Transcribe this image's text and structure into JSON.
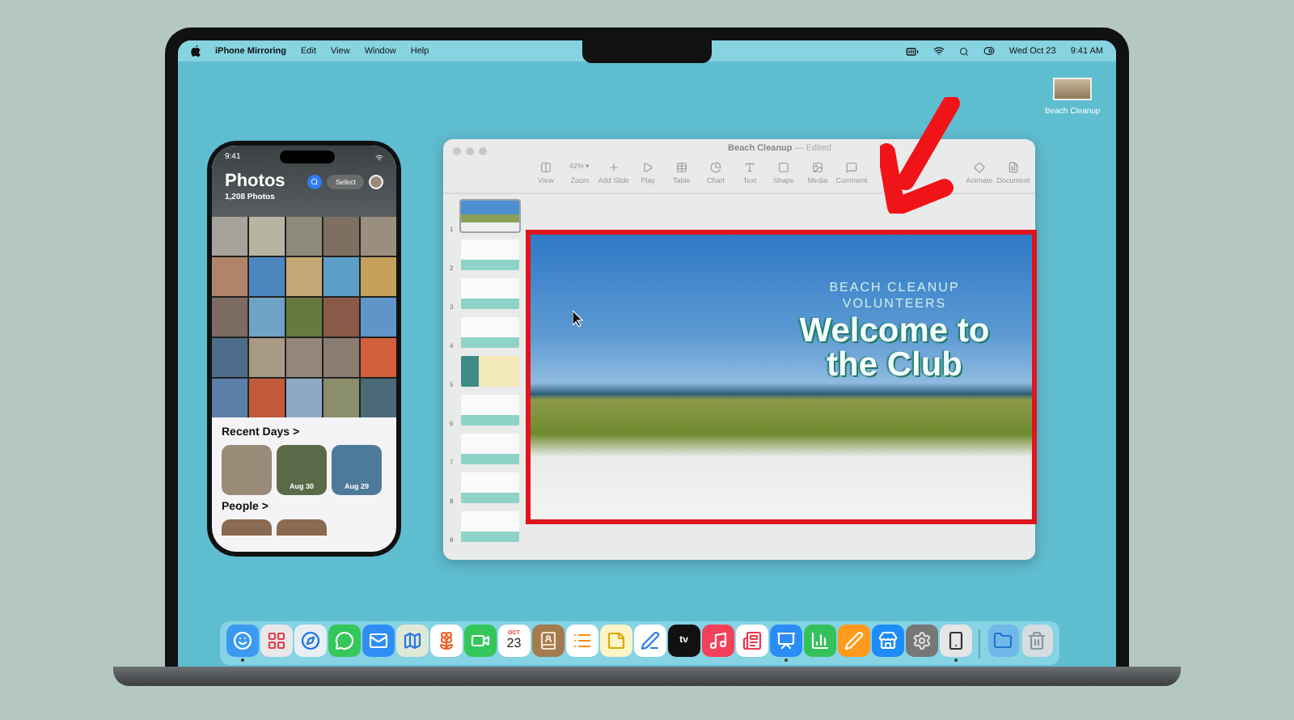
{
  "menu_bar": {
    "app_name": "iPhone Mirroring",
    "menus": [
      "Edit",
      "View",
      "Window",
      "Help"
    ],
    "date": "Wed Oct 23",
    "time": "9:41 AM"
  },
  "desktop_icon": {
    "label": "Beach Cleanup"
  },
  "iphone": {
    "status_time": "9:41",
    "title": "Photos",
    "count": "1,208 Photos",
    "select_button": "Select",
    "recent_days": {
      "heading": "Recent Days",
      "chevron": ">",
      "tiles": [
        {
          "kind": "photo"
        },
        {
          "kind": "photo",
          "label": "Aug 30"
        },
        {
          "kind": "photo",
          "label": "Aug 29"
        }
      ]
    },
    "people": {
      "heading": "People",
      "chevron": ">"
    }
  },
  "keynote": {
    "title": "Beach Cleanup",
    "status": "— Edited",
    "zoom": "42%",
    "zoom_caret": "▾",
    "toolbar": [
      {
        "kind": "view",
        "label": "View"
      },
      {
        "kind": "zoom",
        "label": "Zoom"
      },
      {
        "kind": "add",
        "label": "Add Slide"
      },
      {
        "kind": "play",
        "label": "Play"
      },
      {
        "kind": "table",
        "label": "Table"
      },
      {
        "kind": "chart",
        "label": "Chart"
      },
      {
        "kind": "text",
        "label": "Text"
      },
      {
        "kind": "shape",
        "label": "Shape"
      },
      {
        "kind": "media",
        "label": "Media"
      },
      {
        "kind": "comment",
        "label": "Comment"
      },
      {
        "kind": "animate",
        "label": "Animate"
      },
      {
        "kind": "document",
        "label": "Document"
      }
    ],
    "slides": [
      {
        "number": "1",
        "selected": true
      },
      {
        "number": "2",
        "selected": false
      },
      {
        "number": "3",
        "selected": false
      },
      {
        "number": "4",
        "selected": false
      },
      {
        "number": "5",
        "selected": false
      },
      {
        "number": "6",
        "selected": false
      },
      {
        "number": "7",
        "selected": false
      },
      {
        "number": "8",
        "selected": false
      },
      {
        "number": "9",
        "selected": false
      }
    ],
    "slide": {
      "kicker": "BEACH CLEANUP\nVOLUNTEERS",
      "title": "Welcome to\nthe Club"
    }
  },
  "dock": [
    {
      "kind": "finder",
      "running": true
    },
    {
      "kind": "launchpad",
      "running": false
    },
    {
      "kind": "safari",
      "running": false
    },
    {
      "kind": "messages",
      "running": false
    },
    {
      "kind": "mail",
      "running": false
    },
    {
      "kind": "maps",
      "running": false
    },
    {
      "kind": "photos",
      "running": false
    },
    {
      "kind": "facetime",
      "running": false
    },
    {
      "kind": "calendar",
      "running": false,
      "month": "OCT",
      "day": "23"
    },
    {
      "kind": "contacts",
      "running": false
    },
    {
      "kind": "reminders",
      "running": false
    },
    {
      "kind": "notes",
      "running": false
    },
    {
      "kind": "freeform",
      "running": false
    },
    {
      "kind": "tv",
      "running": false,
      "label": "tv"
    },
    {
      "kind": "music",
      "running": false
    },
    {
      "kind": "news",
      "running": false
    },
    {
      "kind": "keynote",
      "running": true
    },
    {
      "kind": "numbers",
      "running": false
    },
    {
      "kind": "pages",
      "running": false
    },
    {
      "kind": "appstore",
      "running": false
    },
    {
      "kind": "settings",
      "running": false
    },
    {
      "kind": "iphone",
      "running": true
    },
    {
      "kind": "divider"
    },
    {
      "kind": "folder",
      "running": false
    },
    {
      "kind": "trash",
      "running": false
    }
  ]
}
